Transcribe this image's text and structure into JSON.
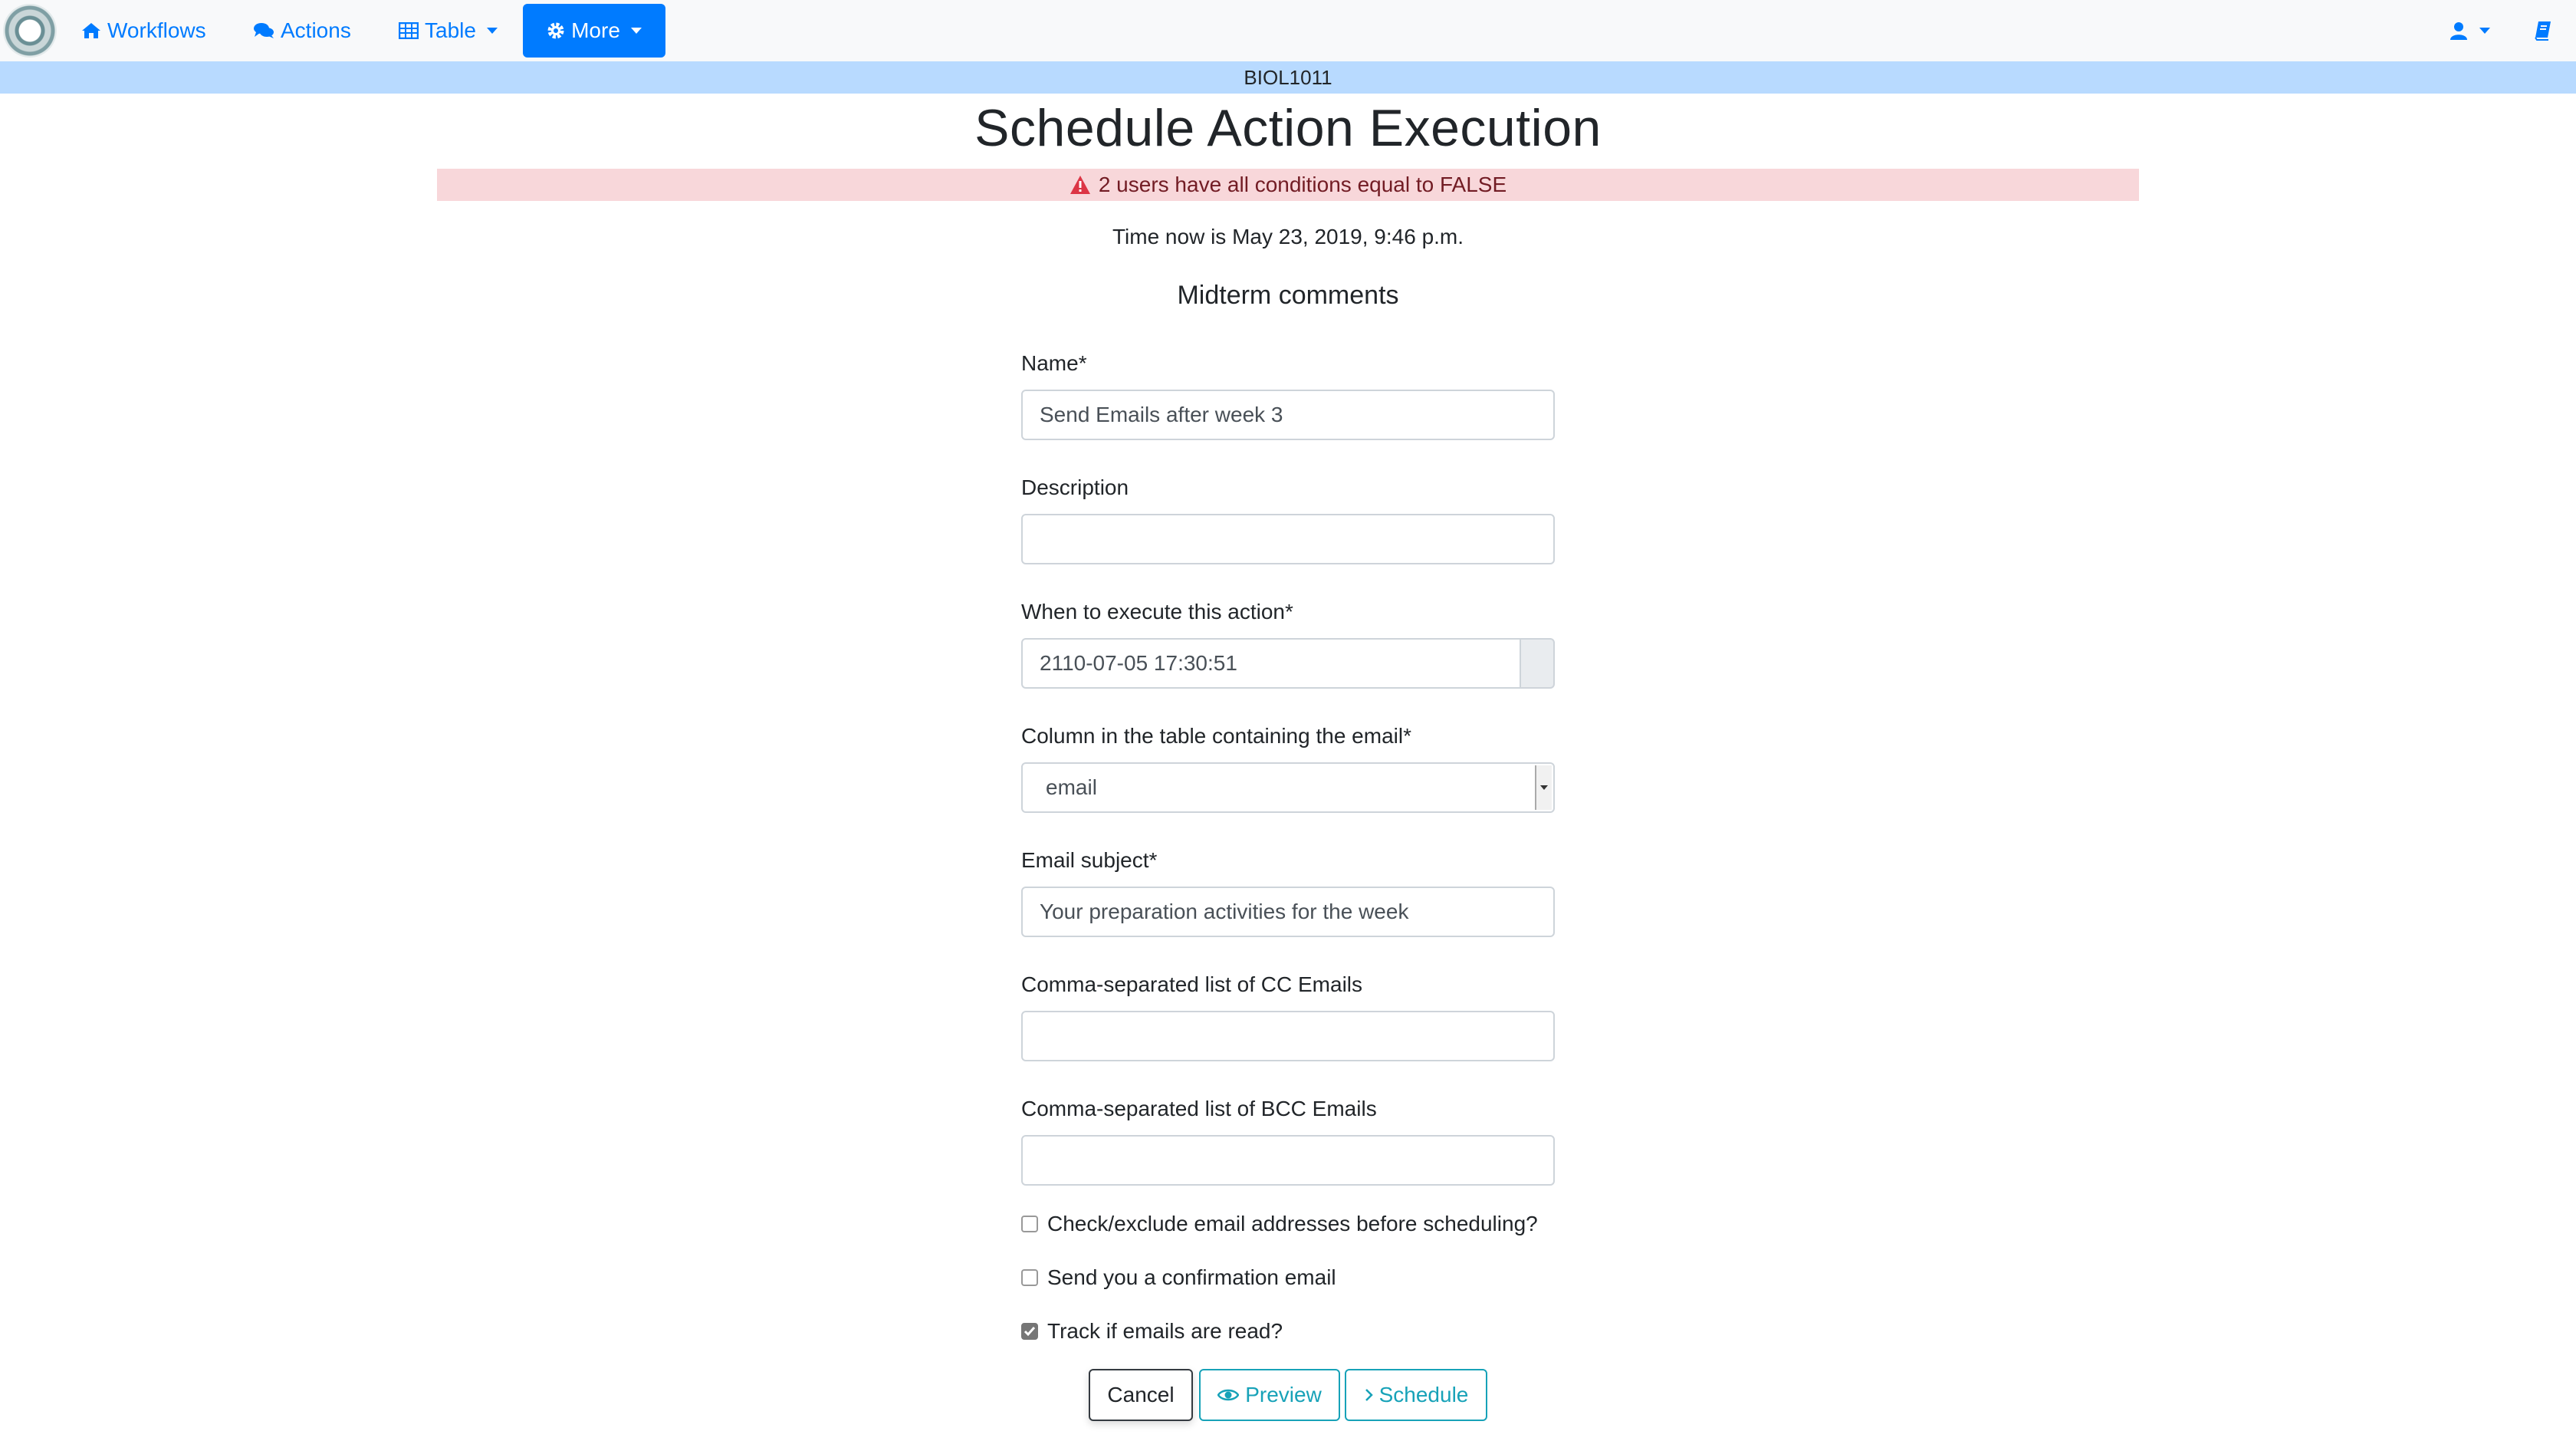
{
  "navbar": {
    "workflows": "Workflows",
    "actions": "Actions",
    "table": "Table",
    "more": "More"
  },
  "workflow_name": "BIOL1011",
  "page_title": "Schedule Action Execution",
  "alert": "2 users have all conditions equal to FALSE",
  "time_now": "Time now is May 23, 2019, 9:46 p.m.",
  "action_name": "Midterm comments",
  "form": {
    "name_label": "Name*",
    "name_value": "Send Emails after week 3",
    "description_label": "Description",
    "description_value": "",
    "when_label": "When to execute this action*",
    "when_value": "2110-07-05 17:30:51",
    "email_column_label": "Column in the table containing the email*",
    "email_column_value": "email",
    "subject_label": "Email subject*",
    "subject_value": "Your preparation activities for the week",
    "cc_label": "Comma-separated list of CC Emails",
    "cc_value": "",
    "bcc_label": "Comma-separated list of BCC Emails",
    "bcc_value": "",
    "check_exclude_label": "Check/exclude email addresses before scheduling?",
    "check_exclude_checked": false,
    "confirm_label": "Send you a confirmation email",
    "confirm_checked": false,
    "track_label": "Track if emails are read?",
    "track_checked": true
  },
  "buttons": {
    "cancel": "Cancel",
    "preview": "Preview",
    "schedule": "Schedule"
  },
  "colors": {
    "primary": "#007bff",
    "info": "#17a2b8",
    "workflow_bar": "#b8daff",
    "alert_bg": "#f8d7da",
    "alert_text": "#721c24"
  },
  "icons": {
    "workflows": "home-icon",
    "actions": "comments-icon",
    "table": "table-icon",
    "more": "cog-icon",
    "user": "user-icon",
    "help": "book-icon",
    "alert": "warning-icon",
    "preview": "eye-icon",
    "schedule": "chevron-right-icon"
  }
}
